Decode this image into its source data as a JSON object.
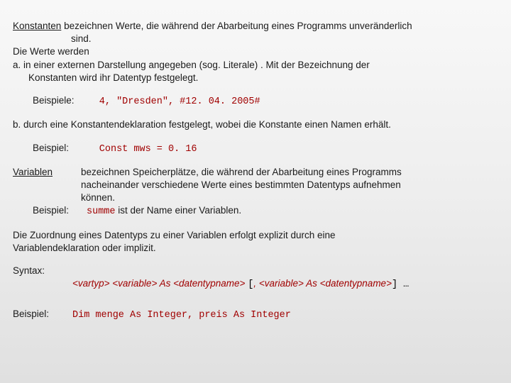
{
  "konstanten": {
    "heading": "Konstanten",
    "line1_rest": " bezeichnen Werte, die während der Abarbeitung eines Programms unveränderlich",
    "line1_cont": "sind.",
    "line2": "Die Werte werden",
    "a_line1": "a.  in einer externen Darstellung angegeben (sog. Literale) . Mit  der Bezeichnung der",
    "a_line2": "Konstanten wird ihr Datentyp festgelegt.",
    "beispiele_label": "Beispiele:",
    "beispiele_code": "4,   \"Dresden\",   #12. 04. 2005#",
    "b_line": "b.  durch eine Konstantendeklaration festgelegt, wobei die Konstante einen Namen erhält.",
    "beispiel_label": "Beispiel:",
    "beispiel_code": "Const mws = 0. 16"
  },
  "variablen": {
    "heading": "Variablen",
    "desc1": "bezeichnen Speicherplätze, die während der Abarbeitung eines Programms",
    "desc2": "nacheinander verschiedene Werte eines bestimmten Datentyps aufnehmen",
    "desc3": "können.",
    "beispiel_label": "Beispiel:",
    "ex_code": "summe",
    "ex_rest": " ist der Name einer Variablen."
  },
  "assign": {
    "line1": "Die Zuordnung eines Datentyps zu einer Variablen erfolgt explizit durch eine",
    "line2": "Variablendeklaration oder implizit."
  },
  "syntax": {
    "label": "Syntax:",
    "p1": "<vartyp> <variable>",
    "as1": " As ",
    "p2": "<datentypname> ",
    "br1": "[",
    "comma": ", ",
    "p3": "<variable>",
    "as2": " As ",
    "p4": "<datentypname>",
    "br2": "] …"
  },
  "final": {
    "label": "Beispiel:",
    "code": "Dim menge As Integer,  preis As Integer"
  }
}
